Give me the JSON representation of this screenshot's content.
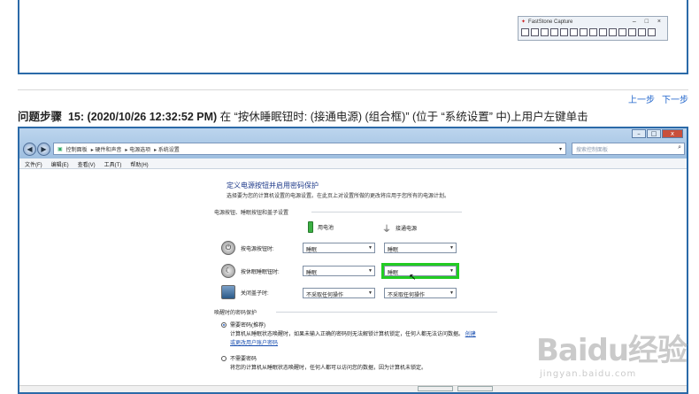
{
  "fastcapture": {
    "title": "FastStone Capture",
    "controls": "– □ ×"
  },
  "nav": {
    "prev": "上一步",
    "next": "下一步"
  },
  "step": {
    "label": "问题步骤",
    "number": "15:",
    "timestamp": "(2020/10/26 12:32:52 PM)",
    "text": "在 “按休睡眠钮时: (接通电源) (组合框)” (位于 “系统设置” 中)上用户左键单击"
  },
  "window": {
    "controls": {
      "min": "–",
      "max": "□",
      "close": "x"
    },
    "back": "◀",
    "forward": "▶",
    "breadcrumbs": [
      "控制面板",
      "硬件和声音",
      "电源选项",
      "系统设置"
    ],
    "search_placeholder": "搜索控制面板",
    "menu": [
      "文件(F)",
      "编辑(E)",
      "查看(V)",
      "工具(T)",
      "帮助(H)"
    ]
  },
  "content": {
    "title": "定义电源按钮并启用密码保护",
    "description": "选择要为您的计算机设置的电源设置。在此页上对设置所做的更改将应用于您所有的电源计划。",
    "section1": "电源按钮、睡眠按钮和盖子设置",
    "col_battery": "用电池",
    "col_plugged": "接通电源",
    "rows": [
      {
        "label": "按电源按钮时:",
        "battery": "睡眠",
        "plugged": "睡眠"
      },
      {
        "label": "按休眠睡眠钮时:",
        "battery": "睡眠",
        "plugged": "睡眠"
      },
      {
        "label": "关闭盖子时:",
        "battery": "不采取任何操作",
        "plugged": "不采取任何操作"
      }
    ],
    "section2": "唤醒时的密码保护",
    "opt1_title": "需要密码(推荐)",
    "opt1_desc": "计算机从睡眠状态唤醒时，如果未输入正确的密码则无法解锁计算机锁定，任何人都无法访问数据。",
    "opt1_more": "创建",
    "opt1_link": "或更改用户账户密码",
    "opt2_title": "不需要密码",
    "opt2_desc": "将您的计算机从睡眠状态唤醒时，任何人都可以访问您的数据，因为计算机未锁定。"
  },
  "watermark": {
    "brand": "Baidu经验",
    "url": "jingyan.baidu.com"
  }
}
